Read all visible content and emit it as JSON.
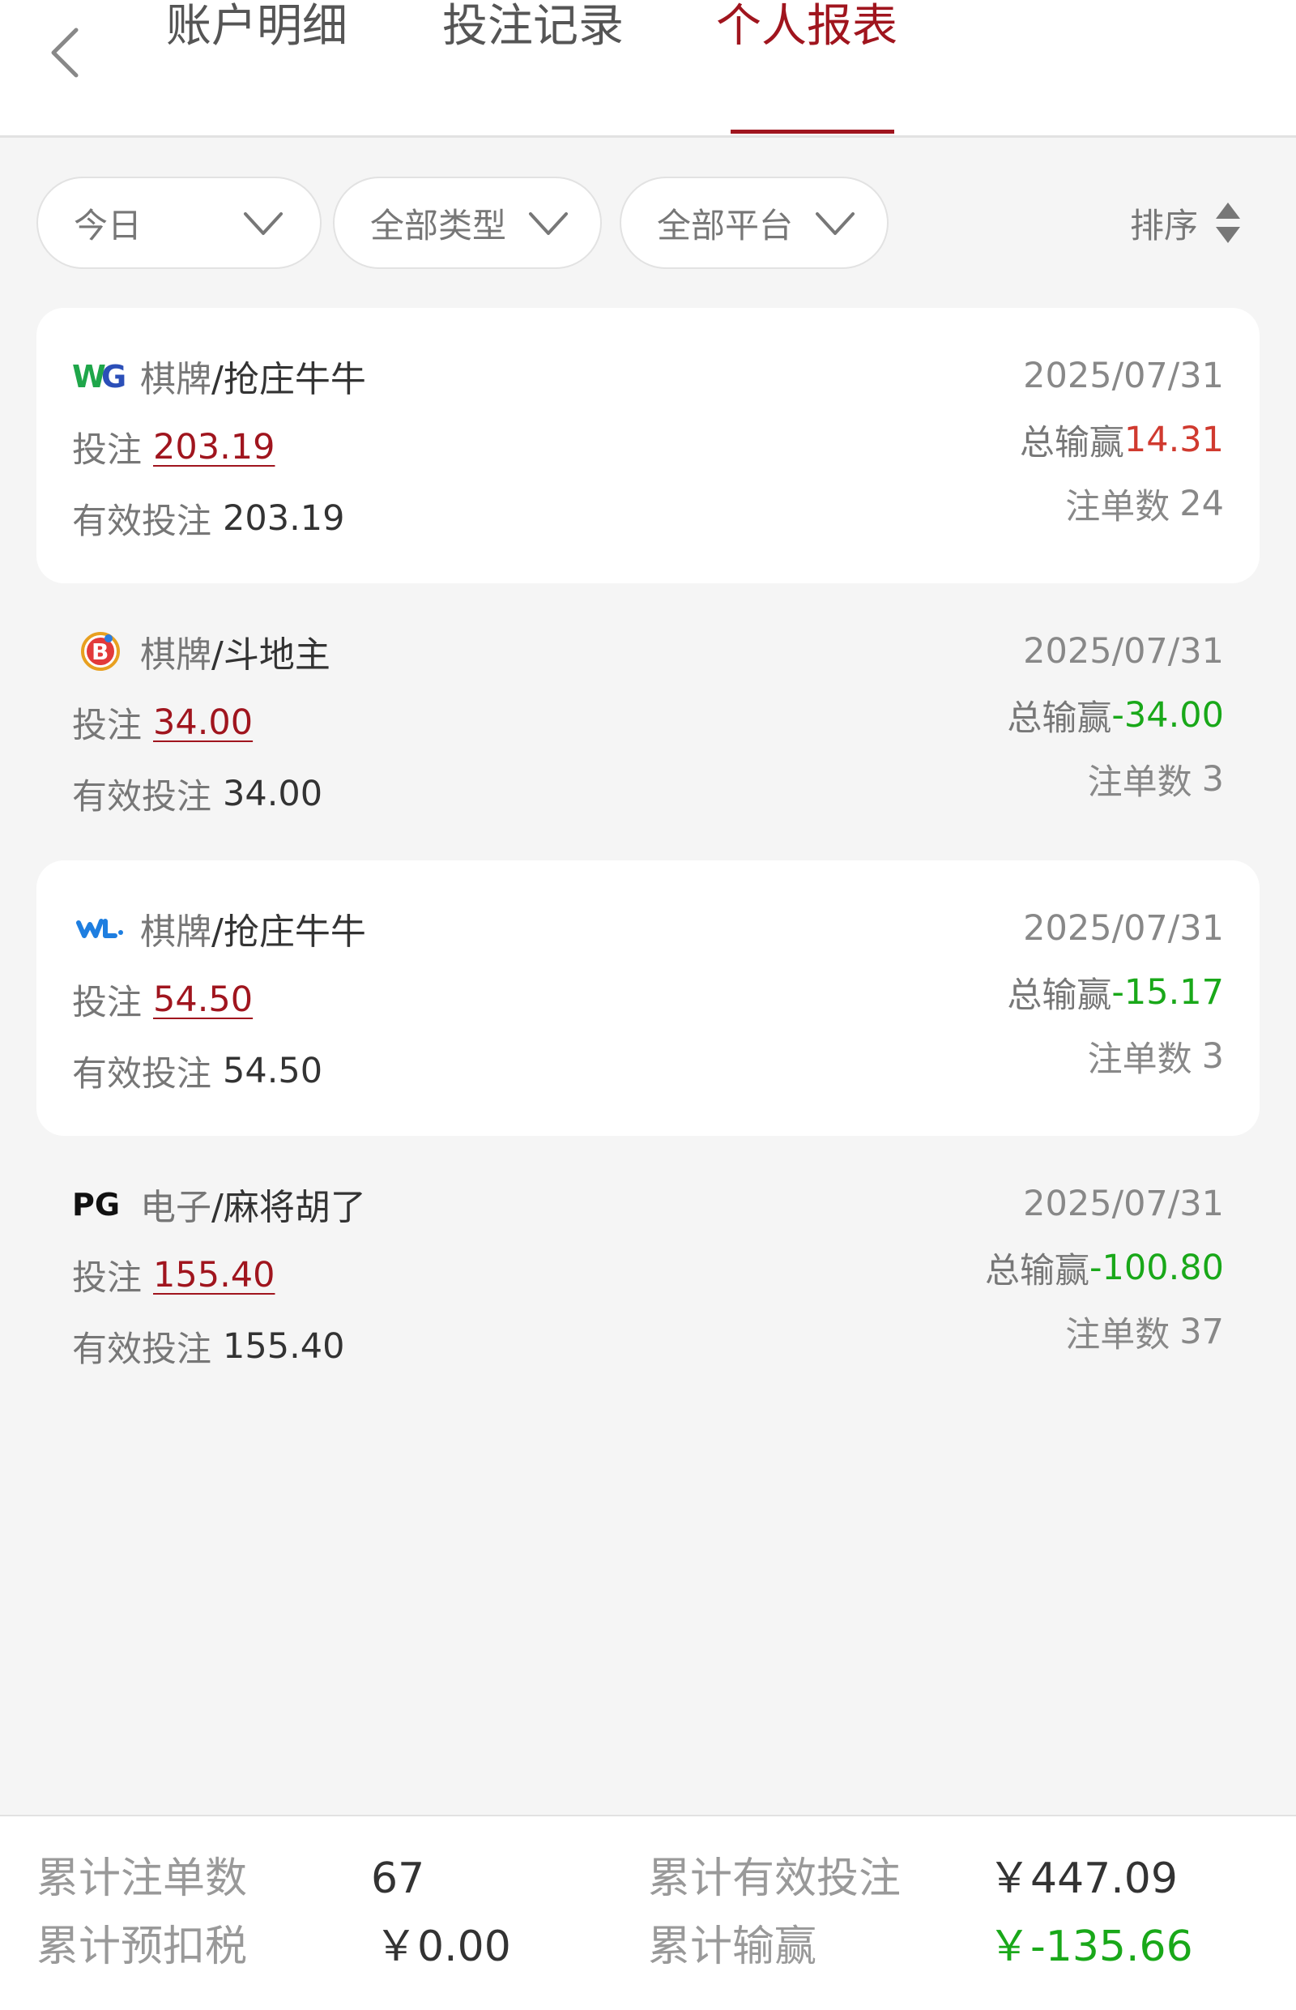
{
  "header": {
    "tabs": [
      {
        "label": "账户明细"
      },
      {
        "label": "投注记录"
      },
      {
        "label": "个人报表"
      }
    ],
    "active_tab": 2
  },
  "filters": {
    "date": "今日",
    "type": "全部类型",
    "platform": "全部平台",
    "sort_label": "排序"
  },
  "records": [
    {
      "logo_icon": "wg-logo-icon",
      "logo_text": "WG",
      "category": "棋牌",
      "game": "/抢庄牛牛",
      "bet_label": "投注",
      "bet": "203.19",
      "valid_label": "有效投注",
      "valid": "203.19",
      "date": "2025/07/31",
      "winloss_label": "总输赢",
      "winloss": "14.31",
      "winloss_positive": true,
      "count_label": "注单数",
      "count": "24"
    },
    {
      "logo_icon": "b-logo-icon",
      "logo_text": "B",
      "category": "棋牌",
      "game": "/斗地主",
      "bet_label": "投注",
      "bet": "34.00",
      "valid_label": "有效投注",
      "valid": "34.00",
      "date": "2025/07/31",
      "winloss_label": "总输赢",
      "winloss": "-34.00",
      "winloss_positive": false,
      "count_label": "注单数",
      "count": "3"
    },
    {
      "logo_icon": "wl-logo-icon",
      "logo_text": "WL",
      "category": "棋牌",
      "game": "/抢庄牛牛",
      "bet_label": "投注",
      "bet": "54.50",
      "valid_label": "有效投注",
      "valid": "54.50",
      "date": "2025/07/31",
      "winloss_label": "总输赢",
      "winloss": "-15.17",
      "winloss_positive": false,
      "count_label": "注单数",
      "count": "3"
    },
    {
      "logo_icon": "pg-logo-icon",
      "logo_text": "PG",
      "category": "电子",
      "game": "/麻将胡了",
      "bet_label": "投注",
      "bet": "155.40",
      "valid_label": "有效投注",
      "valid": "155.40",
      "date": "2025/07/31",
      "winloss_label": "总输赢",
      "winloss": "-100.80",
      "winloss_positive": false,
      "count_label": "注单数",
      "count": "37"
    }
  ],
  "summary": {
    "total_orders_label": "累计注单数",
    "total_orders": "67",
    "total_valid_label": "累计有效投注",
    "total_valid": "￥447.09",
    "total_tax_label": "累计预扣税",
    "total_tax": "￥0.00",
    "total_winloss_label": "累计输赢",
    "total_winloss": "￥-135.66"
  },
  "colors": {
    "accent": "#a0151e",
    "positive": "#d03a2f",
    "negative": "#19a819"
  }
}
